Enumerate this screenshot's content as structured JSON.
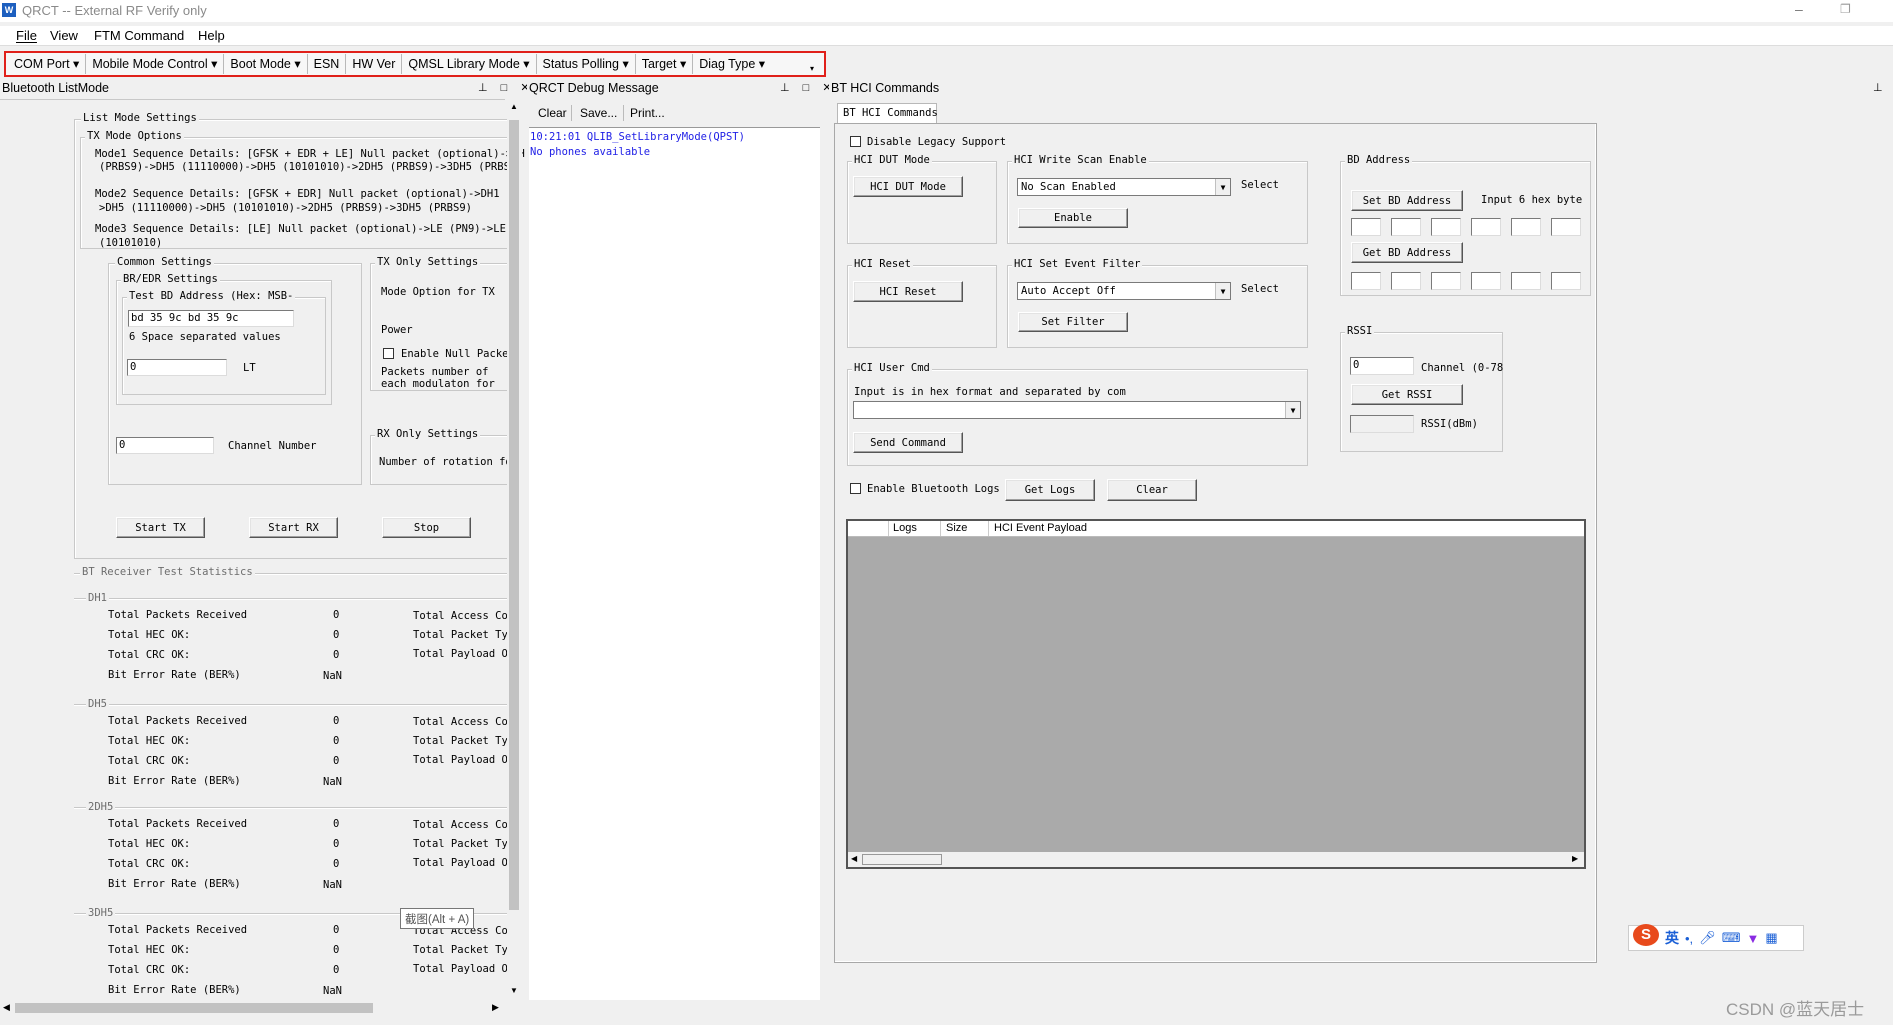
{
  "window": {
    "title": "QRCT -- External RF Verify only",
    "minimize_glyph": "–",
    "restore_glyph": "❐"
  },
  "menu": [
    "File",
    "View",
    "FTM Command",
    "Help"
  ],
  "toolbar": [
    "COM Port",
    "Mobile Mode Control",
    "Boot Mode",
    "ESN",
    "HW Ver",
    "QMSL Library Mode",
    "Status Polling",
    "Target",
    "Diag Type"
  ],
  "left_pane": {
    "title": "Bluetooth ListMode",
    "list_mode": {
      "group_label": "List Mode Settings",
      "tx_mode_options_label": "TX Mode Options",
      "mode1_line1": "Mode1 Sequence Details: [GFSK + EDR + LE] Null packet (optional)->DH",
      "mode1_line2": "(PRBS9)->DH5  (11110000)->DH5  (10101010)->2DH5  (PRBS9)->3DH5  (PRBS",
      "mode2_line1": "Mode2 Sequence Details: [GFSK + EDR] Null packet (optional)->DH1 (P",
      "mode2_line2": ">DH5 (11110000)->DH5 (10101010)->2DH5 (PRBS9)->3DH5 (PRBS9)",
      "mode3_line1": "Mode3 Sequence Details: [LE] Null packet (optional)->LE (PN9)->LE (",
      "mode3_line2": "(10101010)",
      "common_label": "Common Settings",
      "bredr_label": "BR/EDR Settings",
      "bd_addr_label": "Test BD Address (Hex: MSB-",
      "bd_addr_value": "bd 35 9c bd 35 9c",
      "bd_addr_hint": "6 Space separated values",
      "lt_value": "0",
      "lt_label": "LT",
      "channel_value": "0",
      "channel_label": "Channel Number",
      "tx_only_label": "TX Only Settings",
      "mode_option_label": "Mode Option for TX",
      "power_label": "Power",
      "enable_null_label": "Enable Null Packet",
      "packets_number_label1": "Packets number of",
      "packets_number_label2": "each modulaton for",
      "rx_only_label": "RX Only Settings",
      "rotation_label": "Number of rotation fo",
      "start_tx": "Start TX",
      "start_rx": "Start RX",
      "stop": "Stop"
    },
    "stats": {
      "group_label": "BT Receiver Test Statistics",
      "sections": [
        {
          "name": "DH1",
          "received": "0",
          "hec": "0",
          "crc": "0",
          "ber": "NaN"
        },
        {
          "name": "DH5",
          "received": "0",
          "hec": "0",
          "crc": "0",
          "ber": "NaN"
        },
        {
          "name": "2DH5",
          "received": "0",
          "hec": "0",
          "crc": "0",
          "ber": "NaN"
        },
        {
          "name": "3DH5",
          "received": "0",
          "hec": "0",
          "crc": "0",
          "ber": "NaN"
        }
      ],
      "row_received": "Total Packets Received",
      "row_hec": "Total HEC OK:",
      "row_crc": "Total CRC OK:",
      "row_ber": "Bit Error Rate  (BER%)",
      "right_access": "Total Access Code",
      "right_type": "Total Packet Type",
      "right_payload": "Total Payload OK",
      "tooltip": "截图(Alt + A)"
    }
  },
  "middle_pane": {
    "title": "QRCT Debug Message",
    "clear": "Clear",
    "save": "Save...",
    "print": "Print...",
    "log_line1": "10:21:01  QLIB_SetLibraryMode(QPST)",
    "log_line2": "No phones available"
  },
  "right_pane": {
    "title": "BT HCI Commands",
    "tab": "BT HCI Commands",
    "disable_legacy": "Disable Legacy Support",
    "dut_group": "HCI DUT Mode",
    "dut_button": "HCI DUT Mode",
    "scan_group": "HCI Write Scan Enable",
    "scan_combo": "No Scan Enabled",
    "scan_select": "Select",
    "scan_enable": "Enable",
    "reset_group": "HCI Reset",
    "reset_button": "HCI Reset",
    "filter_group": "HCI Set Event Filter",
    "filter_combo": "Auto Accept Off",
    "filter_select": "Select",
    "filter_button": "Set Filter",
    "user_cmd_group": "HCI User Cmd",
    "user_cmd_hint": "Input is in hex format and separated by com",
    "send_command": "Send Command",
    "bd_group": "BD Address",
    "set_bd": "Set BD Address",
    "input_hint": "Input 6  hex byte",
    "get_bd": "Get BD Address",
    "rssi_group": "RSSI",
    "rssi_value": "0",
    "rssi_channel": "Channel (0-78",
    "get_rssi": "Get RSSI",
    "rssi_dbm": "RSSI(dBm)",
    "enable_logs": "Enable Bluetooth Logs",
    "get_logs": "Get Logs",
    "clear_logs": "Clear",
    "log_columns": [
      "Logs",
      "Size",
      "HCI Event Payload"
    ]
  },
  "ime": {
    "lang": "英",
    "icons": [
      "punctuation-icon",
      "mic-icon",
      "keyboard-icon",
      "shirt-icon",
      "grid-icon"
    ]
  },
  "watermark": "CSDN @蓝天居士",
  "colors": {
    "highlight": "#e0201a",
    "log_text": "#1e1ee6",
    "log_area": "#aaaaaa"
  }
}
